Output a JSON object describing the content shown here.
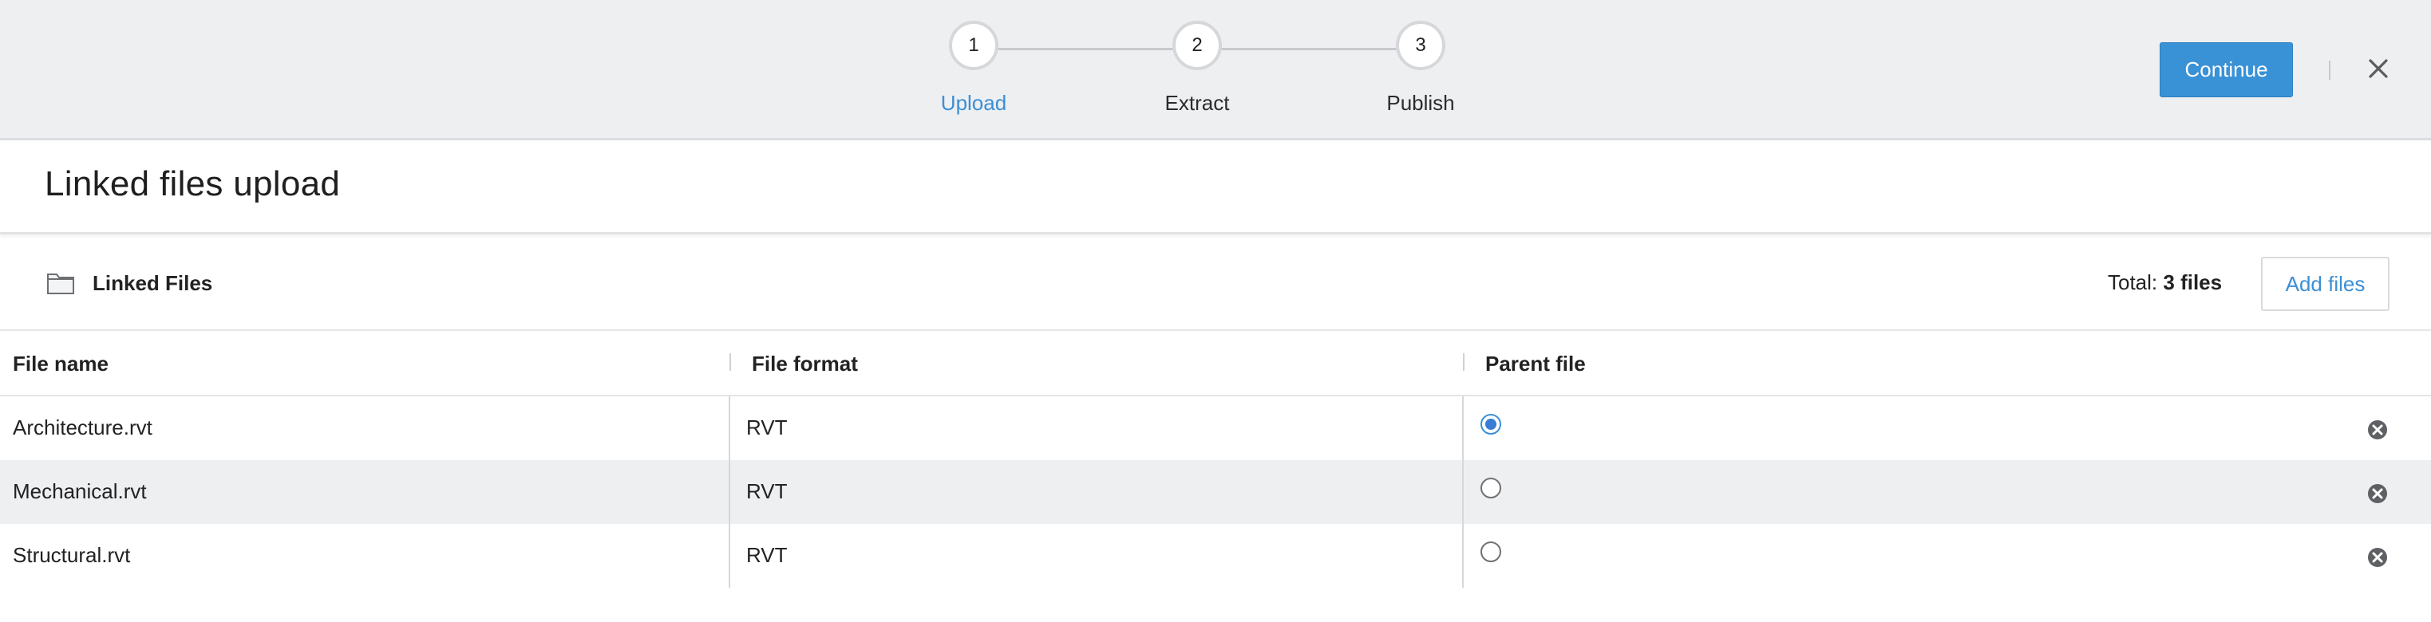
{
  "wizard": {
    "steps": [
      {
        "number": "1",
        "label": "Upload",
        "state": "active"
      },
      {
        "number": "2",
        "label": "Extract",
        "state": "pending"
      },
      {
        "number": "3",
        "label": "Publish",
        "state": "pending"
      }
    ],
    "continue_label": "Continue",
    "close_icon": "close-icon"
  },
  "page": {
    "title": "Linked files upload"
  },
  "toolbar": {
    "folder_icon": "folder-icon",
    "folder_label": "Linked Files",
    "total_prefix": "Total:",
    "total_value": "3 files",
    "add_files_label": "Add files"
  },
  "table": {
    "columns": [
      "File name",
      "File format",
      "Parent file"
    ],
    "rows": [
      {
        "file_name": "Architecture.rvt",
        "format": "RVT",
        "parent": true
      },
      {
        "file_name": "Mechanical.rvt",
        "format": "RVT",
        "parent": false
      },
      {
        "file_name": "Structural.rvt",
        "format": "RVT",
        "parent": false
      }
    ]
  },
  "colors": {
    "accent": "#3a92d6",
    "topbar_bg": "#eeeff1",
    "row_alt_bg": "#eeeff1"
  }
}
